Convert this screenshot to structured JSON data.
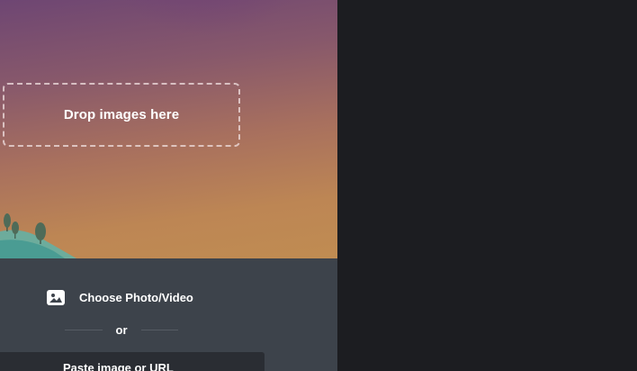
{
  "upload": {
    "drop_zone_label": "Drop images here",
    "choose_label": "Choose Photo/Video",
    "divider_label": "or",
    "paste_label": "Paste image or URL"
  },
  "icons": {
    "choose": "image-icon",
    "landscape": "landscape-illustration"
  },
  "colors": {
    "gradient_top": "#6e4673",
    "gradient_bottom": "#c08c52",
    "panel": "#3d434b",
    "background": "#1c1d21",
    "hill": "#5fb3a9",
    "tree": "#4f6b58"
  }
}
